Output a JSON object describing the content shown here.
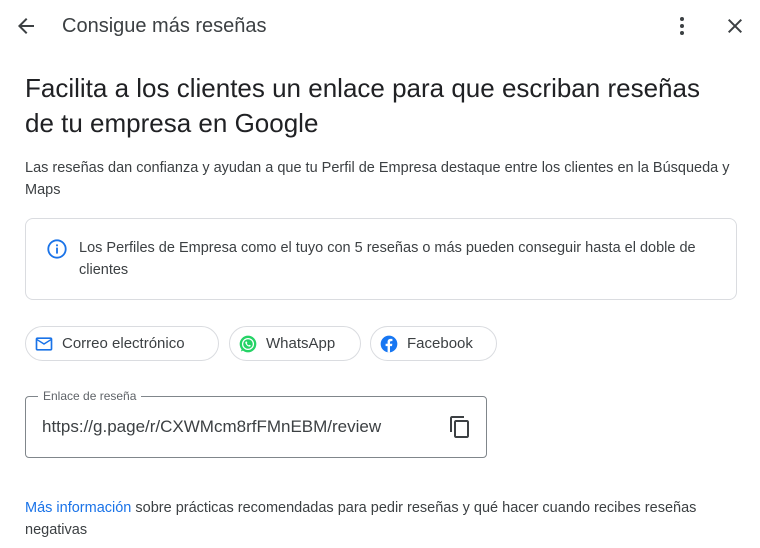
{
  "header": {
    "title": "Consigue más reseñas",
    "back_icon": "arrow-back-icon",
    "more_icon": "more-vert-icon",
    "close_icon": "close-icon"
  },
  "main": {
    "headline": "Facilita a los clientes un enlace para que escriban reseñas de tu empresa en Google",
    "subtext": "Las reseñas dan confianza y ayudan a que tu Perfil de Empresa destaque entre los clientes en la Búsqueda y Maps",
    "info": {
      "text": "Los Perfiles de Empresa como el tuyo con 5 reseñas o más pueden conseguir hasta el doble de clientes",
      "icon": "info-icon"
    },
    "share_chips": [
      {
        "label": "Correo electrónico",
        "icon": "mail-icon"
      },
      {
        "label": "WhatsApp",
        "icon": "whatsapp-icon"
      },
      {
        "label": "Facebook",
        "icon": "facebook-icon"
      }
    ],
    "review_link": {
      "label": "Enlace de reseña",
      "value": "https://g.page/r/CXWMcm8rfFMnEBM/review",
      "copy_icon": "copy-icon"
    },
    "footer": {
      "link_text": "Más información",
      "rest_text": " sobre prácticas recomendadas para pedir reseñas y qué hacer cuando recibes reseñas negativas"
    }
  },
  "colors": {
    "link": "#1a73e8",
    "border": "#dadce0",
    "whatsapp": "#25d366",
    "facebook": "#1877f2"
  }
}
